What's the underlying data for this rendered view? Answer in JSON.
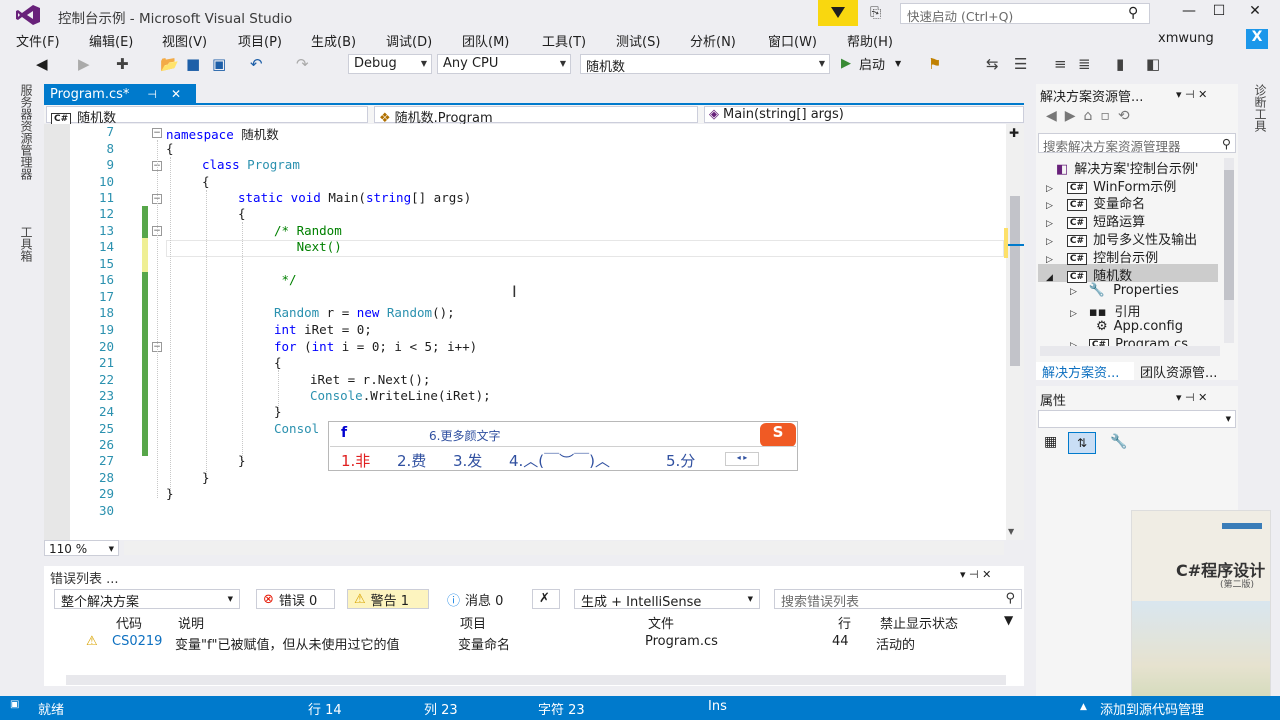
{
  "window": {
    "title": "控制台示例 - Microsoft Visual Studio",
    "quick_launch_placeholder": "快速启动 (Ctrl+Q)",
    "user": "xmwung",
    "user_initial": "X"
  },
  "menu": [
    "文件(F)",
    "编辑(E)",
    "视图(V)",
    "项目(P)",
    "生成(B)",
    "调试(D)",
    "团队(M)",
    "工具(T)",
    "测试(S)",
    "分析(N)",
    "窗口(W)",
    "帮助(H)"
  ],
  "toolbar": {
    "config": "Debug",
    "platform": "Any CPU",
    "project": "随机数",
    "start_label": "启动"
  },
  "left_strip": [
    "服务器资源管理器",
    "工具箱"
  ],
  "right_strip": [
    "诊断工具"
  ],
  "editor": {
    "tab_label": "Program.cs*",
    "nav_project": "随机数",
    "nav_class": "随机数.Program",
    "nav_member": "Main(string[] args)",
    "zoom": "110 %",
    "line_numbers": [
      "7",
      "8",
      "9",
      "10",
      "11",
      "12",
      "13",
      "14",
      "15",
      "16",
      "17",
      "18",
      "19",
      "20",
      "21",
      "22",
      "23",
      "24",
      "25",
      "26",
      "27",
      "28",
      "29",
      "30"
    ],
    "lines": {
      "l7a": "namespace",
      "l7b": " 随机数",
      "l8": "{",
      "l9a": "class",
      "l9b": " Program",
      "l10": "{",
      "l11a": "static",
      "l11b": " void",
      "l11c": " Main(",
      "l11d": "string",
      "l11e": "[] args)",
      "l12": "{",
      "l13": "/* Random",
      "l14": "   Next()",
      "l16": " */",
      "l18a": "Random",
      "l18b": " r = ",
      "l18c": "new",
      "l18d": " Random",
      "l18e": "();",
      "l19a": "int",
      "l19b": " iRet = 0;",
      "l20a": "for",
      "l20b": " (",
      "l20c": "int",
      "l20d": " i = 0; i < 5; i++)",
      "l21": "{",
      "l22": "iRet = r.Next();",
      "l23a": "Console",
      "l23b": ".WriteLine(iRet);",
      "l24": "}",
      "l25": "Consol",
      "l27": "}",
      "l28": "}",
      "l29": "}"
    }
  },
  "ime": {
    "input": "f",
    "more": "6.更多颜文字",
    "candidates": [
      "1.非",
      "2.费",
      "3.发",
      "4.︿(￣︶￣)︿",
      "5.分"
    ],
    "logo": "S"
  },
  "error_list": {
    "title": "错误列表 ...",
    "scope": "整个解决方案",
    "errors": "错误 0",
    "warnings": "警告 1",
    "messages": "消息 0",
    "build_filter": "生成 + IntelliSense",
    "search_placeholder": "搜索错误列表",
    "headers": [
      "代码",
      "说明",
      "项目",
      "文件",
      "行",
      "禁止显示状态"
    ],
    "rows": [
      {
        "code": "CS0219",
        "desc": "变量\"f\"已被赋值，但从未使用过它的值",
        "project": "变量命名",
        "file": "Program.cs",
        "line": "44",
        "state": "活动的"
      }
    ]
  },
  "solution_explorer": {
    "title": "解决方案资源管...",
    "search_placeholder": "搜索解决方案资源管理器",
    "solution": "解决方案'控制台示例'",
    "projects": [
      "WinForm示例",
      "变量命名",
      "短路运算",
      "加号多义性及输出",
      "控制台示例",
      "随机数"
    ],
    "children": [
      "Properties",
      "引用",
      "App.config",
      "Program.cs"
    ],
    "tab1": "解决方案资...",
    "tab2": "团队资源管..."
  },
  "properties": {
    "title": "属性"
  },
  "book": {
    "title": "C#程序设计",
    "edition": "(第二版)"
  },
  "status": {
    "ready": "就绪",
    "line": "行 14",
    "col": "列 23",
    "ch": "字符 23",
    "mode": "Ins",
    "source_control": "添加到源代码管理"
  },
  "colors": {
    "accent": "#007acc",
    "keyword": "#0000ff",
    "type": "#2b91af",
    "comment": "#008000"
  }
}
